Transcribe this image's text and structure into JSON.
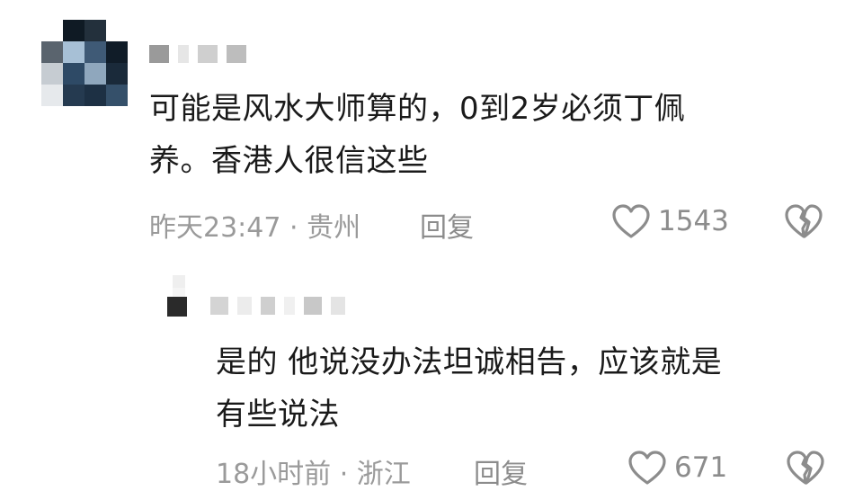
{
  "comment": {
    "content_line1": "可能是风水大师算的，0到2岁必须丁佩",
    "content_line2": "养。香港人很信这些",
    "time_location": "昨天23:47 · 贵州",
    "reply_label": "回复",
    "like_count": "1543"
  },
  "reply": {
    "content_line1": "是的 他说没办法坦诚相告，应该就是",
    "content_line2": "有些说法",
    "time_location": "18小时前 · 浙江",
    "reply_label": "回复",
    "like_count": "671"
  },
  "icons": {
    "like": "heart-outline-icon",
    "dislike": "broken-heart-icon"
  },
  "colors": {
    "text": "#1a1a1a",
    "meta": "#9a9a9a",
    "icon": "#8c8c8c"
  }
}
